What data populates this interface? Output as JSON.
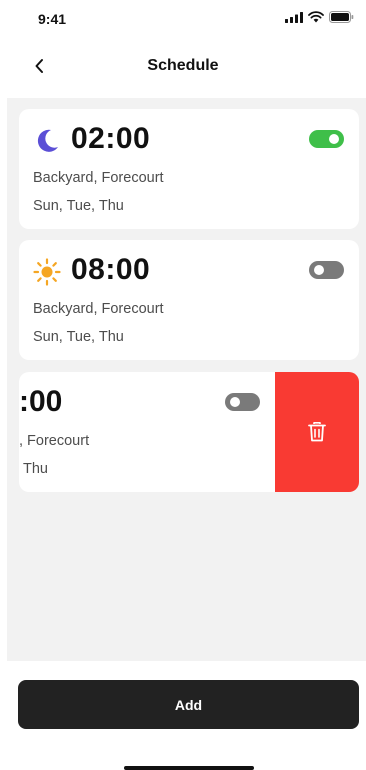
{
  "status_bar": {
    "time": "9:41"
  },
  "header": {
    "title": "Schedule"
  },
  "schedules": [
    {
      "time": "02:00",
      "zones": "Backyard, Forecourt",
      "days": "Sun, Tue, Thu",
      "icon": "moon-icon",
      "enabled": true
    },
    {
      "time": "08:00",
      "zones": "Backyard, Forecourt",
      "days": "Sun, Tue, Thu",
      "icon": "sun-icon",
      "enabled": false
    },
    {
      "time_visible": ":00",
      "zones_visible": ", Forecourt",
      "days_visible": "Thu",
      "enabled": false,
      "revealed_action": "delete"
    }
  ],
  "footer": {
    "add_label": "Add"
  },
  "colors": {
    "accent_on": "#3fbf49",
    "delete": "#f93a33",
    "moon": "#5b4fd6",
    "sun": "#f5a623",
    "add_button": "#222222"
  }
}
